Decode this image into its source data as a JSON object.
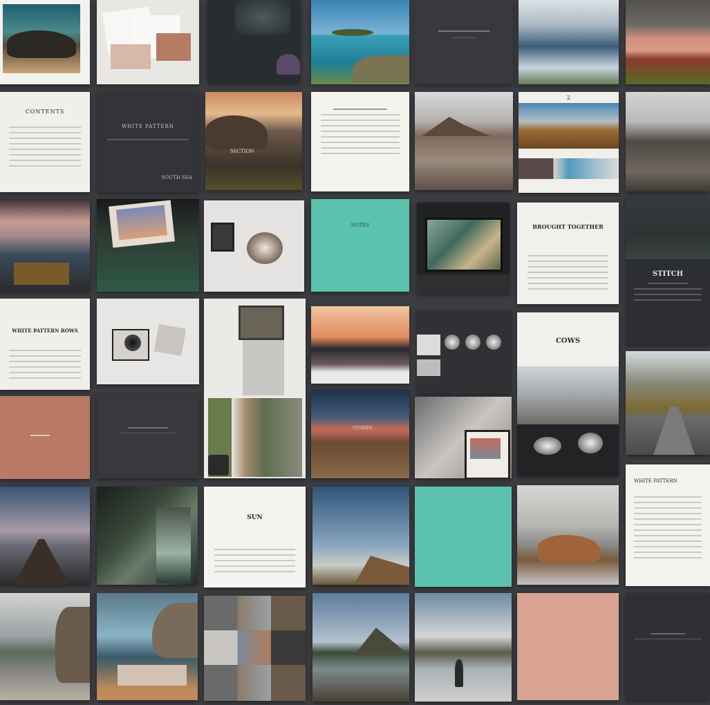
{
  "collage": {
    "title_contents": "CONTENTS",
    "title_white_pattern": "WHITE PATTERN",
    "title_brought_together": "BROUGHT TOGETHER",
    "title_white_pattern_rows": "WHITE PATTERN ROWS",
    "title_crowns": "COWS",
    "title_white_stitch": "STITCH",
    "title_chapter": "SECTION",
    "title_stories": "STORIES",
    "title_sun": "SUN",
    "page_number": "2",
    "dark_footer": "SOUTH SEA",
    "teal_title": "NOTES"
  },
  "colors": {
    "background": "#3c3d41",
    "paper": "#f1efea",
    "charcoal": "#38393d",
    "teal": "#5bc3ad",
    "terracotta": "#b97a66",
    "blush": "#d9a391"
  }
}
